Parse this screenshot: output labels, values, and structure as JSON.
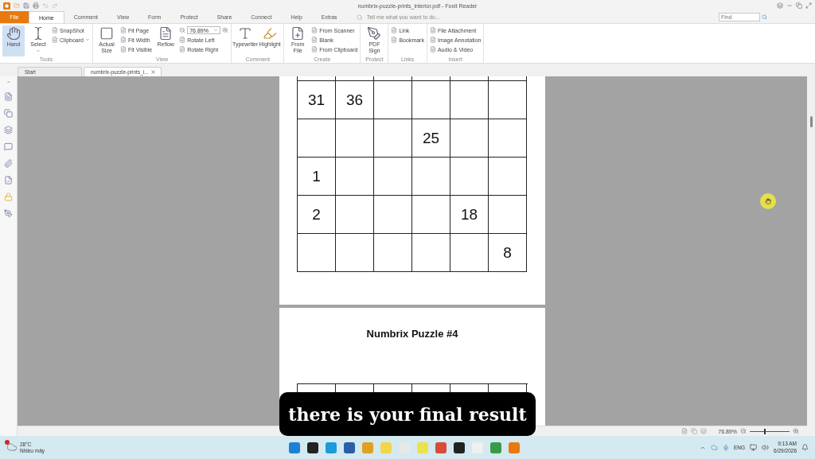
{
  "window": {
    "title": "numbrix-puzzle-prints_interior.pdf - Foxit Reader"
  },
  "ribbon_tabs": [
    {
      "label": "File",
      "kind": "file",
      "selected": false
    },
    {
      "label": "Home",
      "kind": "tab",
      "selected": true
    },
    {
      "label": "Comment",
      "kind": "tab",
      "selected": false
    },
    {
      "label": "View",
      "kind": "tab",
      "selected": false
    },
    {
      "label": "Form",
      "kind": "tab",
      "selected": false
    },
    {
      "label": "Protect",
      "kind": "tab",
      "selected": false
    },
    {
      "label": "Share",
      "kind": "tab",
      "selected": false
    },
    {
      "label": "Connect",
      "kind": "tab",
      "selected": false
    },
    {
      "label": "Help",
      "kind": "tab",
      "selected": false
    },
    {
      "label": "Extras",
      "kind": "tab",
      "selected": false
    }
  ],
  "tell_me": {
    "placeholder": "Tell me what you want to do..."
  },
  "find": {
    "placeholder": "Find"
  },
  "ribbon_groups": [
    {
      "label": "Tools",
      "columns": [
        {
          "kind": "large",
          "label": "Hand",
          "selected": true
        },
        {
          "kind": "large",
          "label": "Select",
          "selected": false,
          "dropdown": true
        },
        {
          "kind": "stack",
          "items": [
            {
              "kind": "button",
              "label": "SnapShot"
            },
            {
              "kind": "button",
              "label": "Clipboard",
              "dropdown": true
            }
          ]
        }
      ]
    },
    {
      "label": "View",
      "columns": [
        {
          "kind": "large",
          "label": "Actual Size",
          "selected": false
        },
        {
          "kind": "stack",
          "items": [
            {
              "kind": "button",
              "label": "Fit Page"
            },
            {
              "kind": "button",
              "label": "Fit Width"
            },
            {
              "kind": "button",
              "label": "Fit Visible"
            }
          ]
        },
        {
          "kind": "large",
          "label": "Reflow",
          "selected": false
        },
        {
          "kind": "stack",
          "items": [
            {
              "kind": "zoom-field",
              "label": "76.89%",
              "dropdown": true
            },
            {
              "kind": "button",
              "label": "Rotate Left"
            },
            {
              "kind": "button",
              "label": "Rotate Right"
            }
          ]
        }
      ]
    },
    {
      "label": "Comment",
      "columns": [
        {
          "kind": "large",
          "label": "Typewriter",
          "selected": false
        },
        {
          "kind": "large",
          "label": "Highlight",
          "selected": false
        }
      ]
    },
    {
      "label": "Create",
      "columns": [
        {
          "kind": "large",
          "label": "From File",
          "selected": false
        },
        {
          "kind": "stack",
          "items": [
            {
              "kind": "button",
              "label": "From Scanner"
            },
            {
              "kind": "button",
              "label": "Blank"
            },
            {
              "kind": "button",
              "label": "From Clipboard"
            }
          ]
        }
      ]
    },
    {
      "label": "Protect",
      "columns": [
        {
          "kind": "large",
          "label": "PDF Sign",
          "selected": false
        }
      ]
    },
    {
      "label": "Links",
      "columns": [
        {
          "kind": "stack",
          "items": [
            {
              "kind": "button",
              "label": "Link"
            },
            {
              "kind": "button",
              "label": "Bookmark"
            }
          ]
        }
      ]
    },
    {
      "label": "Insert",
      "columns": [
        {
          "kind": "stack",
          "items": [
            {
              "kind": "button",
              "label": "File Attachment"
            },
            {
              "kind": "button",
              "label": "Image Annotation"
            },
            {
              "kind": "button",
              "label": "Audio & Video"
            }
          ]
        }
      ]
    }
  ],
  "doc_tabs": [
    {
      "label": "Start",
      "selected": false,
      "closable": false
    },
    {
      "label": "numbrix-puzzle-prints_i...",
      "selected": true,
      "closable": true
    }
  ],
  "page_1": {
    "grid_rows": [
      [
        "31",
        "36",
        "",
        "",
        "",
        ""
      ],
      [
        "",
        "",
        "",
        "25",
        "",
        ""
      ],
      [
        "1",
        "",
        "",
        "",
        "",
        ""
      ],
      [
        "2",
        "",
        "",
        "",
        "18",
        ""
      ],
      [
        "",
        "",
        "",
        "",
        "",
        "8"
      ]
    ]
  },
  "page_2": {
    "title": "Numbrix Puzzle #4"
  },
  "status_bar": {
    "zoom": "76.89%",
    "zoom_slider": {
      "level": 0.35
    }
  },
  "caption": "there is your final result",
  "taskbar": {
    "temperature": "28°C",
    "condition": "Nhiều mây",
    "language": "ENG",
    "time": "9:13 AM",
    "date": "6/29/2026"
  }
}
